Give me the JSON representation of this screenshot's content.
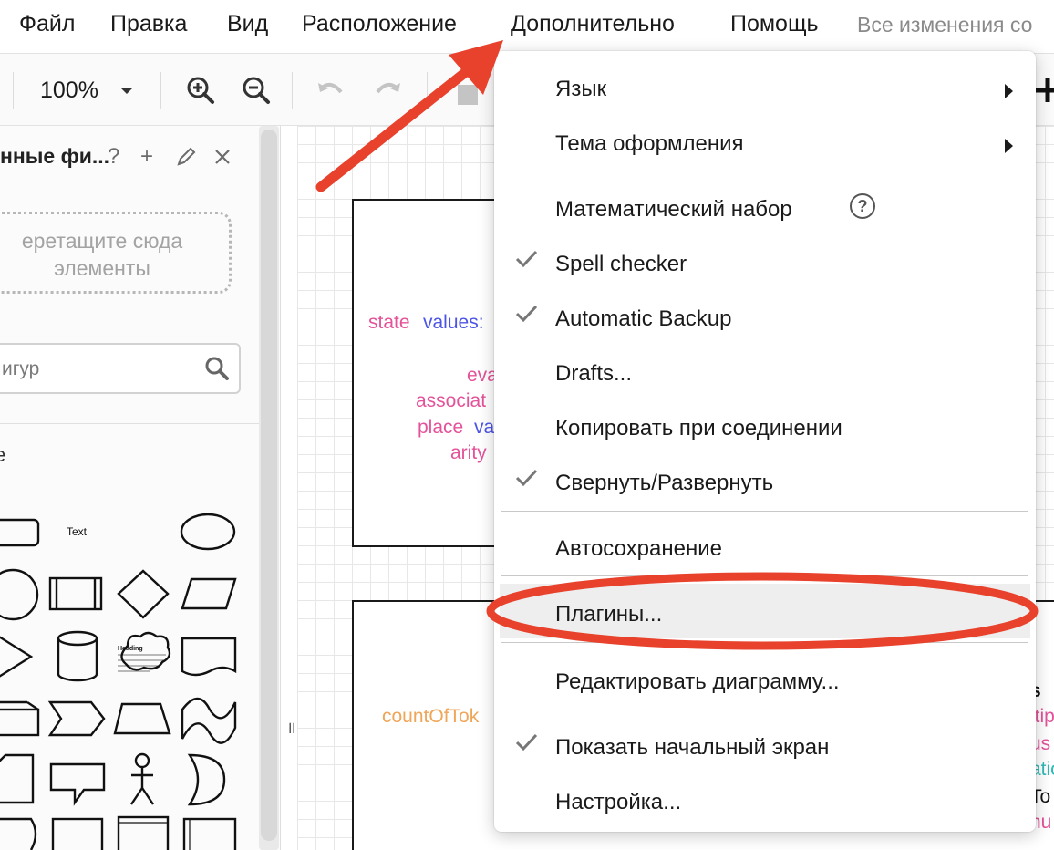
{
  "menubar": {
    "items": [
      "Файл",
      "Правка",
      "Вид",
      "Расположение",
      "Дополнительно",
      "Помощь"
    ],
    "status": "Все изменения со"
  },
  "toolbar": {
    "zoom": "100%"
  },
  "sidebar": {
    "library_title": "нные фи...",
    "help": "?",
    "add": "+",
    "drop_zone_line1": "еретащите сюда",
    "drop_zone_line2": "элементы",
    "search_placeholder": "игур",
    "section_letter": "е",
    "shape_text": "Text",
    "shape_heading": "Heading"
  },
  "canvas": {
    "box1": {
      "line1_a": "state",
      "line1_b": "values:",
      "line2": "eva",
      "line3": "associat",
      "line4_a": "place",
      "line4_b": "va",
      "line5": "arity"
    },
    "box2": {
      "left_text": "countOfTok",
      "right_1": "s",
      "right_2": "ltip",
      "right_3": "us",
      "right_4": "atio",
      "right_5": "To",
      "right_6": "nu"
    },
    "split_handle": "॥"
  },
  "dropdown": {
    "items": [
      {
        "label": "Язык"
      },
      {
        "label": "Тема оформления"
      },
      {
        "label": "Математический набор",
        "help": "?"
      },
      {
        "label": "Spell checker"
      },
      {
        "label": "Automatic Backup"
      },
      {
        "label": "Drafts..."
      },
      {
        "label": "Копировать при соединении"
      },
      {
        "label": "Свернуть/Развернуть"
      },
      {
        "label": "Автосохранение"
      },
      {
        "label": "Плагины..."
      },
      {
        "label": "Редактировать диаграмму..."
      },
      {
        "label": "Показать начальный экран"
      },
      {
        "label": "Настройка..."
      }
    ],
    "checked": [
      "Spell checker",
      "Automatic Backup",
      "Свернуть/Развернуть",
      "Показать начальный экран"
    ],
    "submenus": [
      "Язык",
      "Тема оформления"
    ],
    "highlighted": "Плагины..."
  },
  "annotation_colors": {
    "arrow": "#e8412c",
    "ellipse": "#e8412c"
  }
}
